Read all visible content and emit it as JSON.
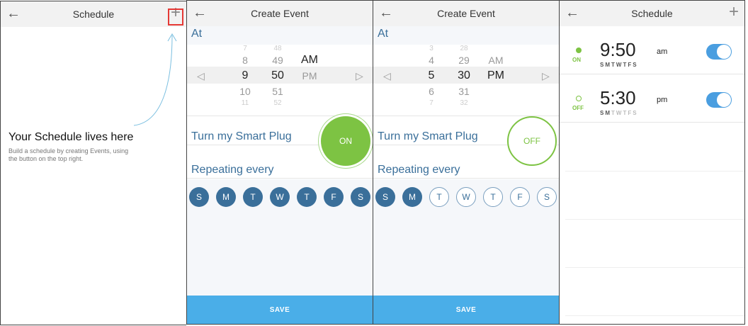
{
  "panel1": {
    "nav_title": "Schedule",
    "heading": "Your Schedule lives here",
    "subtext": "Build a schedule by creating Events, using the button on the top right."
  },
  "panel2": {
    "nav_title": "Create Event",
    "at_label": "At",
    "hours": [
      "7",
      "8",
      "9",
      "10",
      "11"
    ],
    "minutes": [
      "48",
      "49",
      "50",
      "51",
      "52"
    ],
    "meridiem": [
      "AM",
      "PM"
    ],
    "turn_label": "Turn my Smart Plug",
    "state": "ON",
    "repeat_label": "Repeating every",
    "days": [
      "S",
      "M",
      "T",
      "W",
      "T",
      "F",
      "S"
    ],
    "save": "SAVE"
  },
  "panel3": {
    "nav_title": "Create Event",
    "at_label": "At",
    "hours": [
      "3",
      "4",
      "5",
      "6",
      "7"
    ],
    "minutes": [
      "28",
      "29",
      "30",
      "31",
      "32"
    ],
    "meridiem": [
      "AM",
      "PM"
    ],
    "turn_label": "Turn my Smart Plug",
    "state": "OFF",
    "repeat_label": "Repeating every",
    "days": [
      "S",
      "M",
      "T",
      "W",
      "T",
      "F",
      "S"
    ],
    "save": "SAVE"
  },
  "panel4": {
    "nav_title": "Schedule",
    "events": [
      {
        "state": "ON",
        "time": "9:50",
        "ampm": "am",
        "days": [
          "S",
          "M",
          "T",
          "W",
          "T",
          "F",
          "S"
        ]
      },
      {
        "state": "OFF",
        "time": "5:30",
        "ampm": "pm",
        "days": [
          "S",
          "M",
          "T",
          "W",
          "T",
          "F",
          "S"
        ]
      }
    ]
  },
  "icons": {
    "back": "←",
    "plus": "+",
    "left_triangle": "◁",
    "right_triangle": "▷"
  },
  "colors": {
    "accent_blue": "#3a6f9a",
    "save_blue": "#4aaee8",
    "green": "#7dc343",
    "toggle_blue": "#4a9ee0",
    "highlight_red": "#e53935"
  }
}
